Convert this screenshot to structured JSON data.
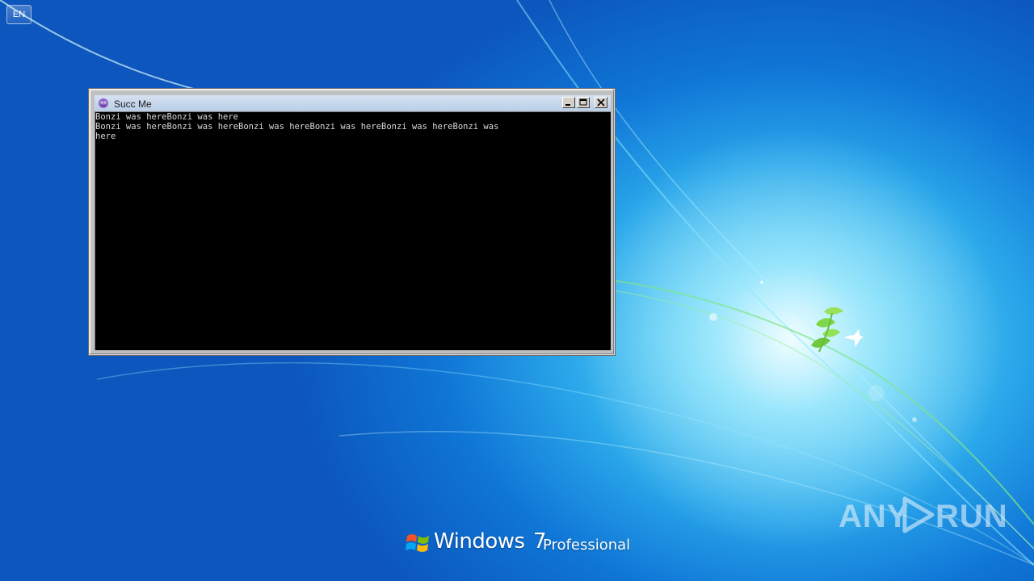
{
  "desktop": {
    "language_indicator": "EN",
    "wallpaper_colors": {
      "deep": "#0c56bd",
      "mid": "#2aa7ea",
      "glow": "#bff1ff"
    }
  },
  "window": {
    "title": "Succ Me",
    "icon": "bonzi-purple-icon",
    "console_lines": [
      "Bonzi was hereBonzi was here",
      "Bonzi was hereBonzi was hereBonzi was hereBonzi was hereBonzi was hereBonzi was",
      "here"
    ],
    "console_colors": {
      "background": "#000000",
      "text": "#d9d9d9"
    }
  },
  "branding": {
    "os_name": "Windows",
    "os_version": "7",
    "os_edition": "Professional"
  },
  "watermark": {
    "left": "ANY",
    "right": "RUN"
  }
}
